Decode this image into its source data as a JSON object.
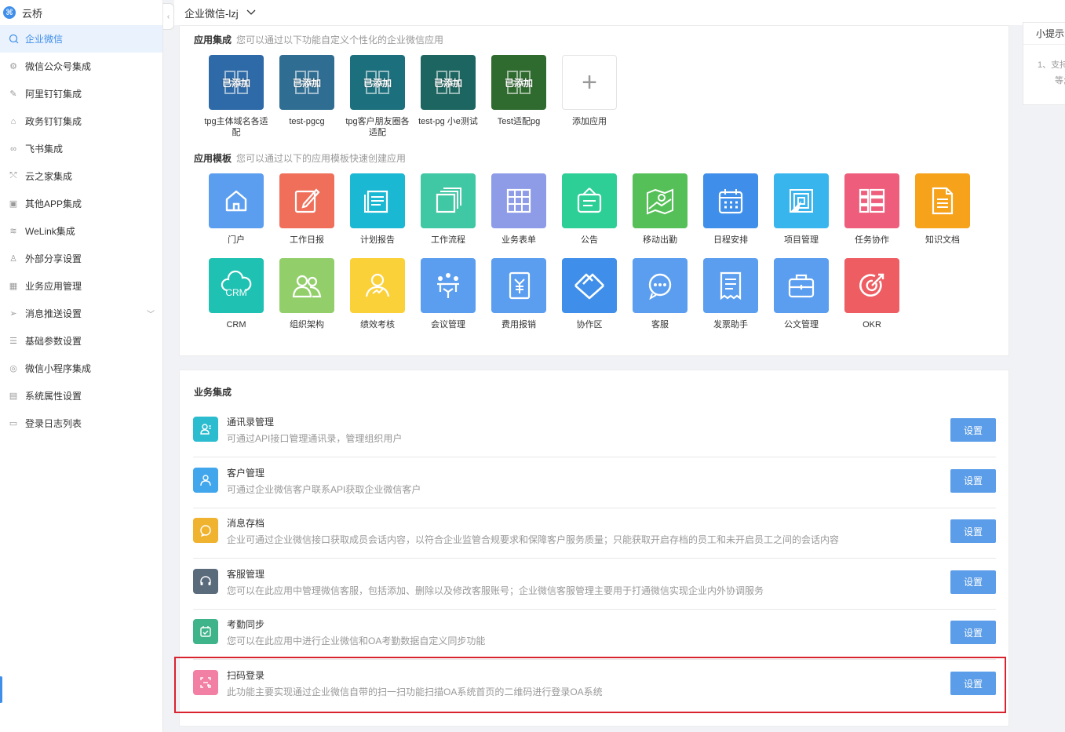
{
  "sidebar": {
    "brand": "云桥",
    "items": [
      {
        "label": "企业微信",
        "icon": "chat-icon",
        "active": true
      },
      {
        "label": "微信公众号集成",
        "icon": "gear-icon"
      },
      {
        "label": "阿里钉钉集成",
        "icon": "pin-icon"
      },
      {
        "label": "政务钉钉集成",
        "icon": "building-icon"
      },
      {
        "label": "飞书集成",
        "icon": "link-icon"
      },
      {
        "label": "云之家集成",
        "icon": "share-icon"
      },
      {
        "label": "其他APP集成",
        "icon": "apps-icon"
      },
      {
        "label": "WeLink集成",
        "icon": "layers-icon"
      },
      {
        "label": "外部分享设置",
        "icon": "user-icon"
      },
      {
        "label": "业务应用管理",
        "icon": "grid-icon"
      },
      {
        "label": "消息推送设置",
        "icon": "send-icon",
        "expandable": true
      },
      {
        "label": "基础参数设置",
        "icon": "sliders-icon"
      },
      {
        "label": "微信小程序集成",
        "icon": "miniprogram-icon"
      },
      {
        "label": "系统属性设置",
        "icon": "settings-panel-icon"
      },
      {
        "label": "登录日志列表",
        "icon": "log-icon"
      }
    ]
  },
  "topbar": {
    "title": "企业微信-lzj"
  },
  "hint": {
    "title": "小提示",
    "text1": "1、支持",
    "text2": "等;"
  },
  "integration": {
    "title": "应用集成",
    "subtitle": "您可以通过以下功能自定义个性化的企业微信应用",
    "added_tag": "已添加",
    "apps": [
      {
        "label": "tpg主体域名各适配",
        "color": "#2e6aa8"
      },
      {
        "label": "test-pgcg",
        "color": "#2f6e92"
      },
      {
        "label": "tpg客户朋友圈各适配",
        "color": "#1c6f7c"
      },
      {
        "label": "test-pg 小e测试",
        "color": "#1c6560"
      },
      {
        "label": "Test适配pg",
        "color": "#2f6b2e"
      }
    ],
    "add_label": "添加应用"
  },
  "templates": {
    "title": "应用模板",
    "subtitle": "您可以通过以下的应用模板快速创建应用",
    "items": [
      {
        "label": "门户",
        "color": "#5b9ef0",
        "icon": "home-icon"
      },
      {
        "label": "工作日报",
        "color": "#ef6f5a",
        "icon": "edit-icon"
      },
      {
        "label": "计划报告",
        "color": "#1bb8d3",
        "icon": "report-icon"
      },
      {
        "label": "工作流程",
        "color": "#40c7a4",
        "icon": "stack-icon"
      },
      {
        "label": "业务表单",
        "color": "#8e9ce8",
        "icon": "table-icon"
      },
      {
        "label": "公告",
        "color": "#2dcf97",
        "icon": "notice-icon"
      },
      {
        "label": "移动出勤",
        "color": "#56c058",
        "icon": "map-icon"
      },
      {
        "label": "日程安排",
        "color": "#3f8fea",
        "icon": "calendar-icon"
      },
      {
        "label": "项目管理",
        "color": "#39b5ee",
        "icon": "project-icon"
      },
      {
        "label": "任务协作",
        "color": "#ee5d7c",
        "icon": "list-icon"
      },
      {
        "label": "知识文档",
        "color": "#f6a21b",
        "icon": "document-icon"
      },
      {
        "label": "CRM",
        "color": "#1fc2b2",
        "icon": "crm-icon"
      },
      {
        "label": "组织架构",
        "color": "#92cf6a",
        "icon": "people-icon"
      },
      {
        "label": "绩效考核",
        "color": "#fbd13a",
        "icon": "performance-icon"
      },
      {
        "label": "会议管理",
        "color": "#5b9ef0",
        "icon": "meeting-icon"
      },
      {
        "label": "费用报销",
        "color": "#5b9ef0",
        "icon": "expense-icon"
      },
      {
        "label": "协作区",
        "color": "#3f8fea",
        "icon": "handshake-icon"
      },
      {
        "label": "客服",
        "color": "#5b9ef0",
        "icon": "chat-bubble-icon"
      },
      {
        "label": "发票助手",
        "color": "#5b9ef0",
        "icon": "invoice-icon"
      },
      {
        "label": "公文管理",
        "color": "#5b9ef0",
        "icon": "briefcase-icon"
      },
      {
        "label": "OKR",
        "color": "#ee5d62",
        "icon": "target-icon"
      }
    ]
  },
  "business": {
    "title": "业务集成",
    "button_label": "设置",
    "rows": [
      {
        "name": "通讯录管理",
        "desc": "可通过API接口管理通讯录，管理组织用户",
        "color": "#2bbccf",
        "icon": "contacts-icon"
      },
      {
        "name": "客户管理",
        "desc": "可通过企业微信客户联系API获取企业微信客户",
        "color": "#41a6ec",
        "icon": "customer-icon"
      },
      {
        "name": "消息存档",
        "desc": "企业可通过企业微信接口获取成员会话内容，以符合企业监管合规要求和保障客户服务质量；只能获取开启存档的员工和未开启员工之间的会话内容",
        "color": "#f0b330",
        "icon": "message-icon"
      },
      {
        "name": "客服管理",
        "desc": "您可以在此应用中管理微信客服，包括添加、删除以及修改客服账号；企业微信客服管理主要用于打通微信实现企业内外协调服务",
        "color": "#5a6b7b",
        "icon": "headset-icon"
      },
      {
        "name": "考勤同步",
        "desc": "您可以在此应用中进行企业微信和OA考勤数据自定义同步功能",
        "color": "#3fb38a",
        "icon": "attendance-icon"
      },
      {
        "name": "扫码登录",
        "desc": "此功能主要实现通过企业微信自带的扫一扫功能扫描OA系统首页的二维码进行登录OA系统",
        "color": "#f27fa4",
        "icon": "scan-icon"
      }
    ]
  }
}
